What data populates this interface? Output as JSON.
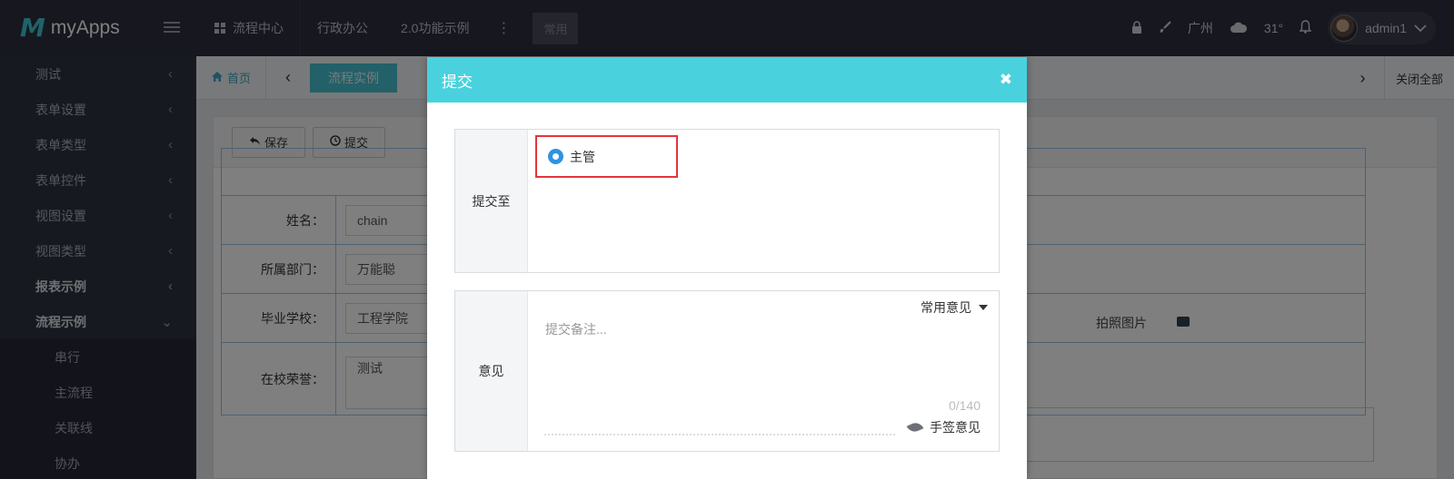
{
  "topbar": {
    "app_name": "myApps",
    "nav": [
      "流程中心",
      "行政办公",
      "2.0功能示例"
    ],
    "nav_more": "⋮",
    "chip": "常用",
    "city": "广州",
    "temperature": "31°",
    "user": "admin1"
  },
  "sidebar": {
    "items": [
      "测试",
      "表单设置",
      "表单类型",
      "表单控件",
      "视图设置",
      "视图类型",
      "报表示例",
      "流程示例"
    ],
    "subitems": [
      "串行",
      "主流程",
      "关联线",
      "协办"
    ]
  },
  "tabs": {
    "home": "首页",
    "active": "流程实例",
    "close_all": "关闭全部"
  },
  "toolbar": {
    "save": "保存",
    "submit": "提交"
  },
  "form": {
    "rows": [
      {
        "label": "姓名：",
        "value": "chain"
      },
      {
        "label": "所属部门：",
        "value": "万能聪"
      },
      {
        "label": "毕业学校：",
        "value": "工程学院"
      },
      {
        "label": "在校荣誉：",
        "value": "测试"
      }
    ],
    "photo_label": "拍照图片"
  },
  "modal": {
    "title": "提交",
    "close": "✖",
    "submit_to_label": "提交至",
    "option": "主管",
    "opinion_label": "意见",
    "common_opinion": "常用意见",
    "remark_placeholder": "提交备注...",
    "counter": "0/140",
    "sign": "手签意见"
  }
}
